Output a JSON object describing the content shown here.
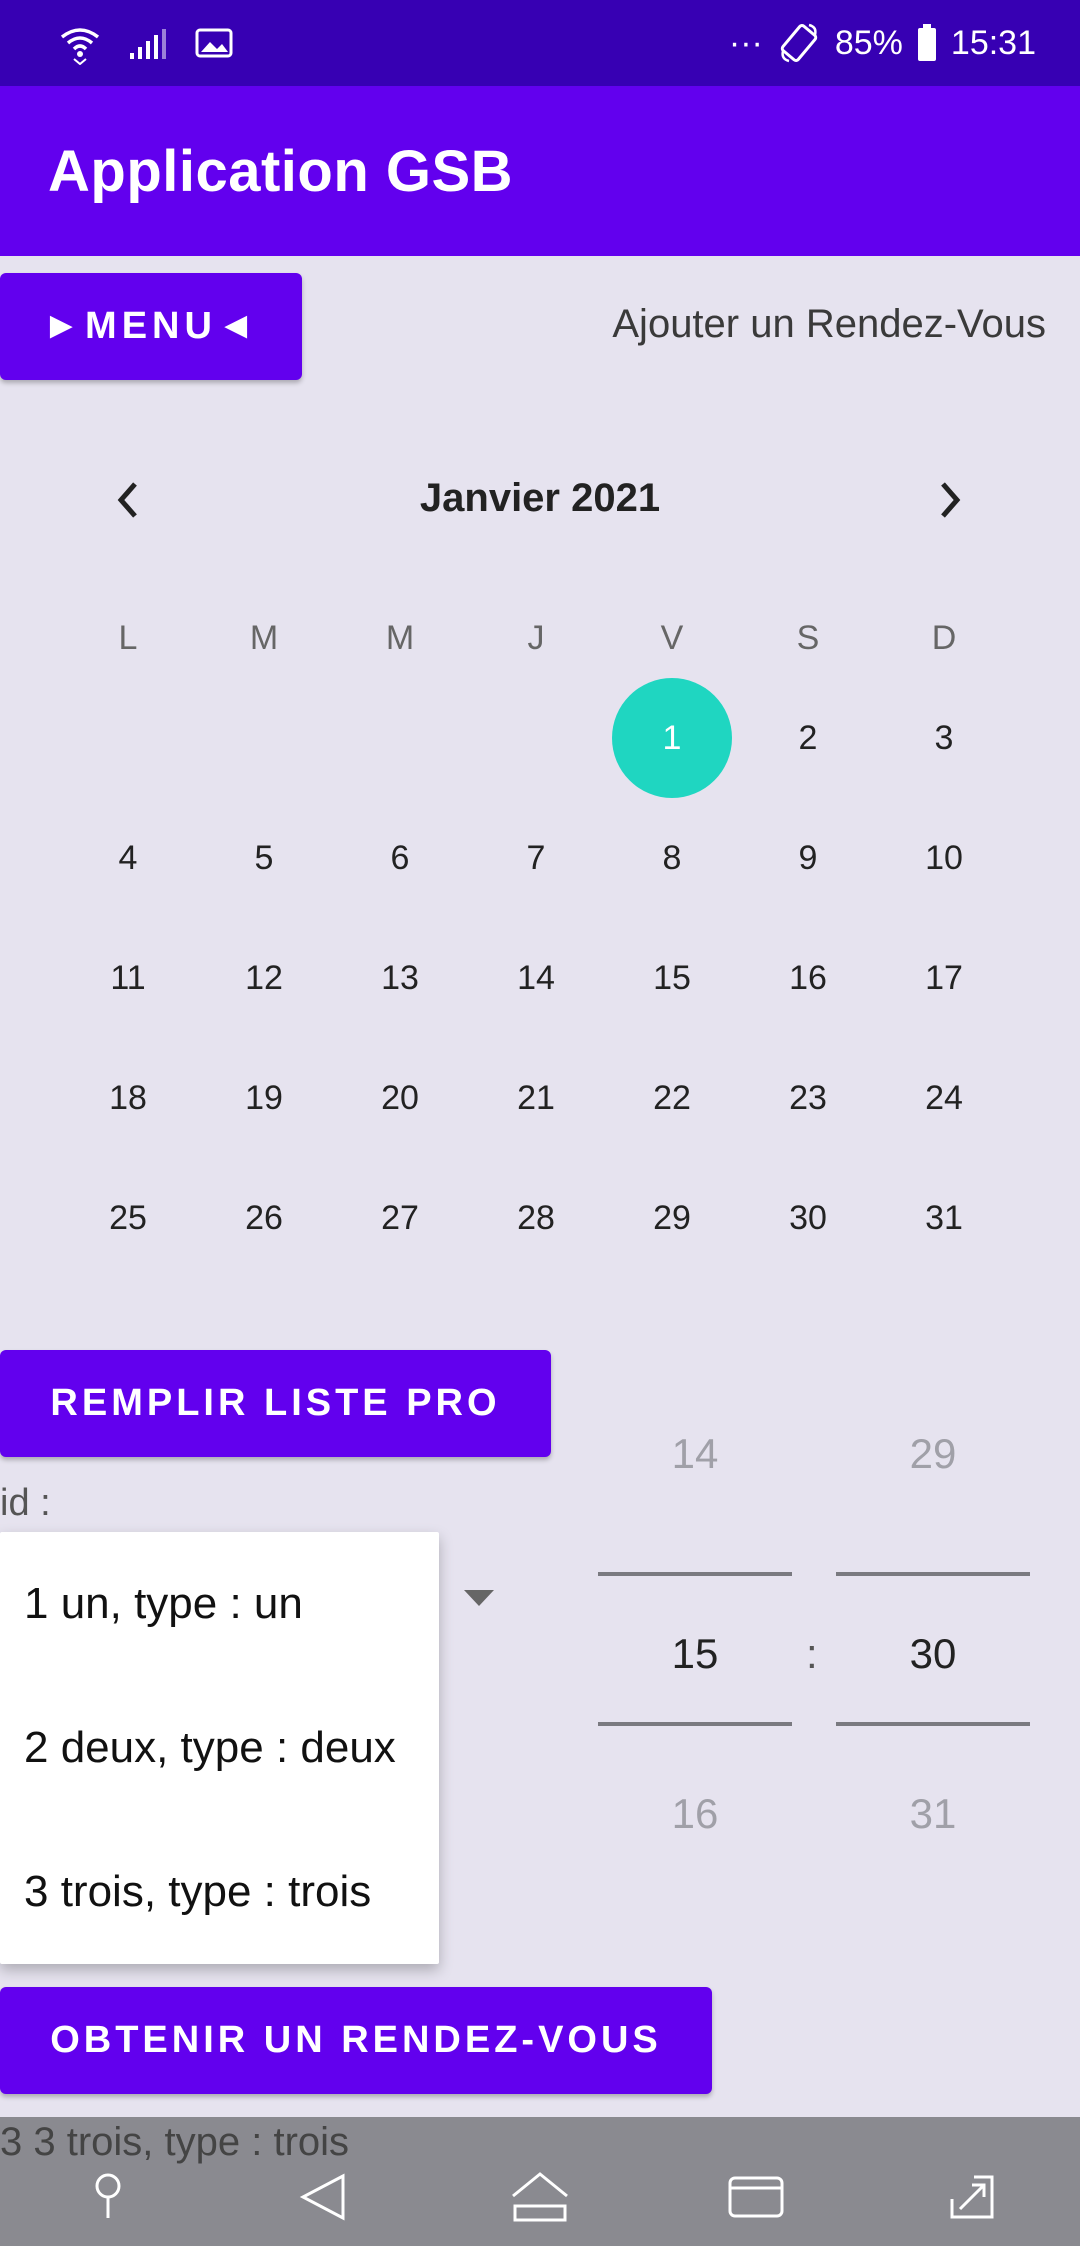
{
  "status_bar": {
    "more": "···",
    "battery": "85%",
    "time": "15:31"
  },
  "app_bar": {
    "title": "Application GSB"
  },
  "menu_button": {
    "label": "►MENU◄"
  },
  "add_rdv": {
    "label": "Ajouter un Rendez-Vous"
  },
  "calendar": {
    "month": "Janvier 2021",
    "days_of_week": [
      "L",
      "M",
      "M",
      "J",
      "V",
      "S",
      "D"
    ],
    "selected_day": "1",
    "weeks": [
      [
        "",
        "",
        "",
        "",
        "1",
        "2",
        "3"
      ],
      [
        "4",
        "5",
        "6",
        "7",
        "8",
        "9",
        "10"
      ],
      [
        "11",
        "12",
        "13",
        "14",
        "15",
        "16",
        "17"
      ],
      [
        "18",
        "19",
        "20",
        "21",
        "22",
        "23",
        "24"
      ],
      [
        "25",
        "26",
        "27",
        "28",
        "29",
        "30",
        "31"
      ]
    ],
    "selected_color": "#1fd6c1"
  },
  "remplir_button": {
    "label": "REMPLIR LISTE PRO"
  },
  "id_label": "id :",
  "dropdown": {
    "options": [
      "1 un, type : un",
      "2 deux, type : deux",
      "3 trois, type : trois"
    ]
  },
  "time_picker": {
    "hour_prev": "14",
    "hour": "15",
    "hour_next": "16",
    "minute_prev": "29",
    "minute": "30",
    "minute_next": "31",
    "separator": ":"
  },
  "obtenir_button": {
    "label": "OBTENIR UN RENDEZ-VOUS"
  },
  "result_text": "3 3 trois, type : trois",
  "colors": {
    "primary": "#6200ee",
    "primary_dark": "#3700b3",
    "background": "#e6e3ef"
  }
}
